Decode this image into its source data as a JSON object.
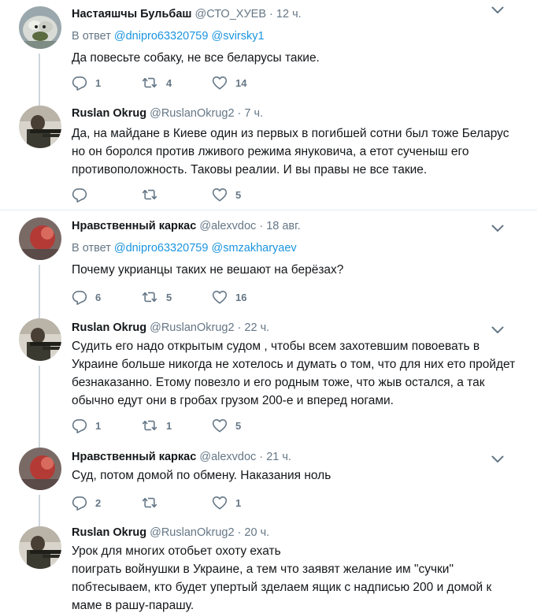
{
  "tweets": [
    {
      "name": "Настаяшчы Бульбаш",
      "handle": "@СТО_ХУЕВ",
      "time": "12 ч.",
      "reply_prefix": "В ответ",
      "mentions": [
        "@dnipro63320759",
        "@svirsky1"
      ],
      "text": "Да повесьте собаку, не все беларусы такие.",
      "replies": "1",
      "retweets": "4",
      "likes": "14"
    },
    {
      "name": "Ruslan Okrug",
      "handle": "@RuslanOkrug2",
      "time": "7 ч.",
      "text": "Да, на майдане в Киеве один из первых в погибшей сотни был тоже Беларус но он боролся против лживого режима януковича, а етот сученыш его противоположность. Таковы реалии. И вы правы не все такие.",
      "replies": "",
      "retweets": "",
      "likes": "5"
    },
    {
      "name": "Нравственный каркас",
      "handle": "@alexvdoc",
      "time": "18 авг.",
      "reply_prefix": "В ответ",
      "mentions": [
        "@dnipro63320759",
        "@smzakharyaev"
      ],
      "text": "Почему укрианцы таких не вешают на берёзах?",
      "replies": "6",
      "retweets": "5",
      "likes": "16"
    },
    {
      "name": "Ruslan Okrug",
      "handle": "@RuslanOkrug2",
      "time": "22 ч.",
      "text": "Судить его надо открытым судом , чтобы всем захотевшим повоевать в Украине больше никогда не хотелось и думать о том, что для них ето пройдет безнаказанно. Етому повезло и его родным тоже, что жыв остался, а так обычно едут они в гробах грузом 200-е и вперед ногами.",
      "replies": "1",
      "retweets": "1",
      "likes": "5"
    },
    {
      "name": "Нравственный каркас",
      "handle": "@alexvdoc",
      "time": "21 ч.",
      "text": "Суд, потом домой по обмену. Наказания ноль",
      "replies": "2",
      "retweets": "",
      "likes": "1"
    },
    {
      "name": "Ruslan Okrug",
      "handle": "@RuslanOkrug2",
      "time": "20 ч.",
      "text_lines": [
        "Урок для многих отобьет охоту ехать",
        "поиграть войнушки в Украине,  а тем что заявят желание им \"сучки\"",
        "побтесываем, кто будет упертый зделаем ящик с надписью 200 и домой к",
        "маме в рашу-парашу."
      ]
    }
  ],
  "icons": {
    "reply": "reply-icon",
    "retweet": "retweet-icon",
    "like": "heart-icon",
    "more": "chevron-down-icon"
  },
  "colors": {
    "text": "#14171a",
    "secondary": "#657786",
    "link": "#1b95e0",
    "thread_line": "#ccd6dd",
    "divider": "#e6ecf0"
  }
}
